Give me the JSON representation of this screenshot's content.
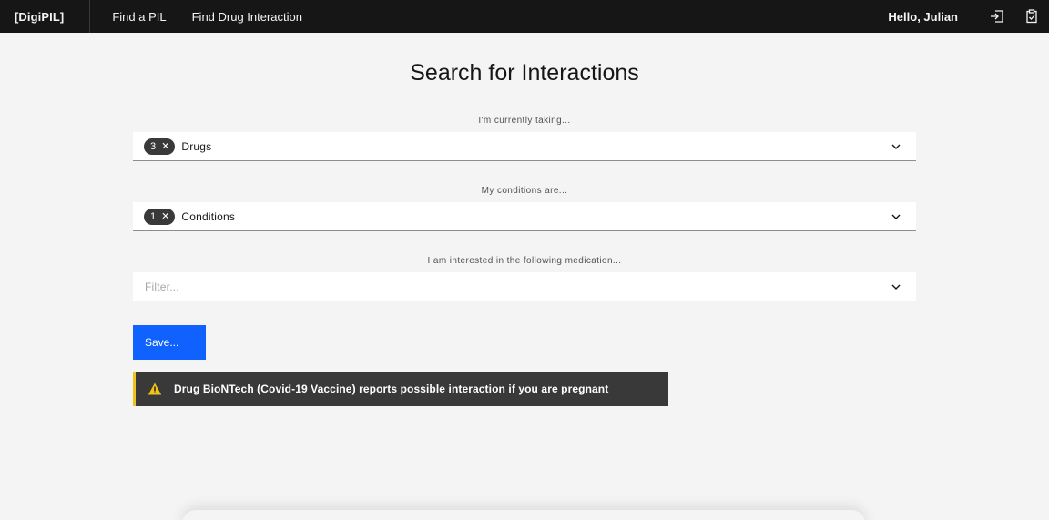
{
  "header": {
    "brand": "[DigiPIL]",
    "nav": [
      "Find a PIL",
      "Find Drug Interaction"
    ],
    "greeting": "Hello, Julian",
    "icons": [
      "login-icon",
      "clipboard-check-icon"
    ]
  },
  "page": {
    "title": "Search for Interactions"
  },
  "drugs": {
    "label": "I'm currently taking...",
    "count": "3",
    "text": "Drugs"
  },
  "conditions": {
    "label": "My conditions are...",
    "count": "1",
    "text": "Conditions"
  },
  "medication": {
    "label": "I am interested in the following medication...",
    "placeholder": "Filter...",
    "value": ""
  },
  "save": {
    "label": "Save..."
  },
  "notification": {
    "text": "Drug BioNTech (Covid-19 Vaccine) reports possible interaction if you are pregnant",
    "icon": "warning-icon"
  },
  "colors": {
    "header_bg": "#161616",
    "primary": "#0f62fe",
    "warning": "#f1c21b",
    "page_bg": "#f4f4f4"
  }
}
